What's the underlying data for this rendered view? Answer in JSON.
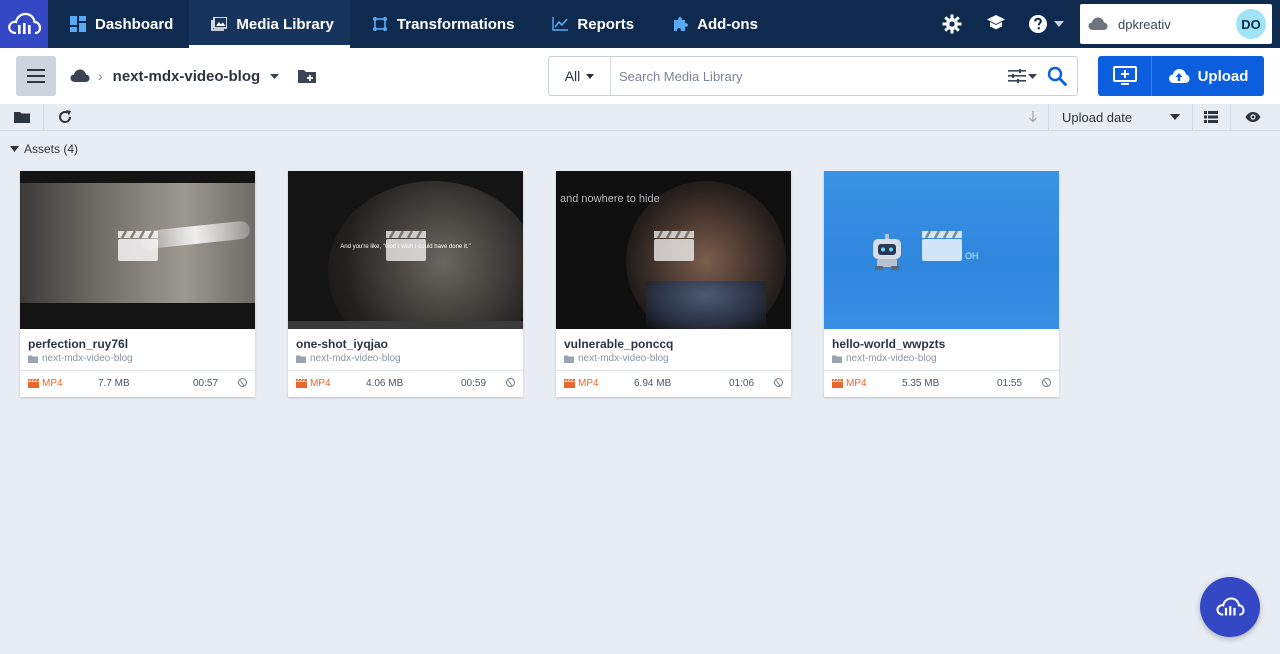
{
  "nav": {
    "items": [
      {
        "label": "Dashboard",
        "icon": "dashboard-icon"
      },
      {
        "label": "Media Library",
        "icon": "media-library-icon",
        "active": true
      },
      {
        "label": "Transformations",
        "icon": "transformations-icon"
      },
      {
        "label": "Reports",
        "icon": "reports-icon"
      },
      {
        "label": "Add-ons",
        "icon": "addons-icon"
      }
    ],
    "account_name": "dpkreativ",
    "avatar_initials": "DO",
    "brand_color": "#3448c5",
    "nav_bg_color": "#0e2a4e"
  },
  "breadcrumb": {
    "folder": "next-mdx-video-blog"
  },
  "search": {
    "filter_label": "All",
    "placeholder": "Search Media Library",
    "value": ""
  },
  "upload": {
    "label": "Upload",
    "color": "#0b5fde"
  },
  "toolbar": {
    "sort_label": "Upload date"
  },
  "assets": {
    "header": "Assets (4)",
    "items": [
      {
        "name": "perfection_ruy76l",
        "folder": "next-mdx-video-blog",
        "format": "MP4",
        "size": "7.7 MB",
        "duration": "00:57"
      },
      {
        "name": "one-shot_iyqjao",
        "folder": "next-mdx-video-blog",
        "format": "MP4",
        "size": "4.06 MB",
        "duration": "00:59",
        "caption": "And you're like, \"God I wish I could have done it.\""
      },
      {
        "name": "vulnerable_ponccq",
        "folder": "next-mdx-video-blog",
        "format": "MP4",
        "size": "6.94 MB",
        "duration": "01:06",
        "caption": "and nowhere to hide"
      },
      {
        "name": "hello-world_wwpzts",
        "folder": "next-mdx-video-blog",
        "format": "MP4",
        "size": "5.35 MB",
        "duration": "01:55",
        "caption": "OH"
      }
    ]
  }
}
